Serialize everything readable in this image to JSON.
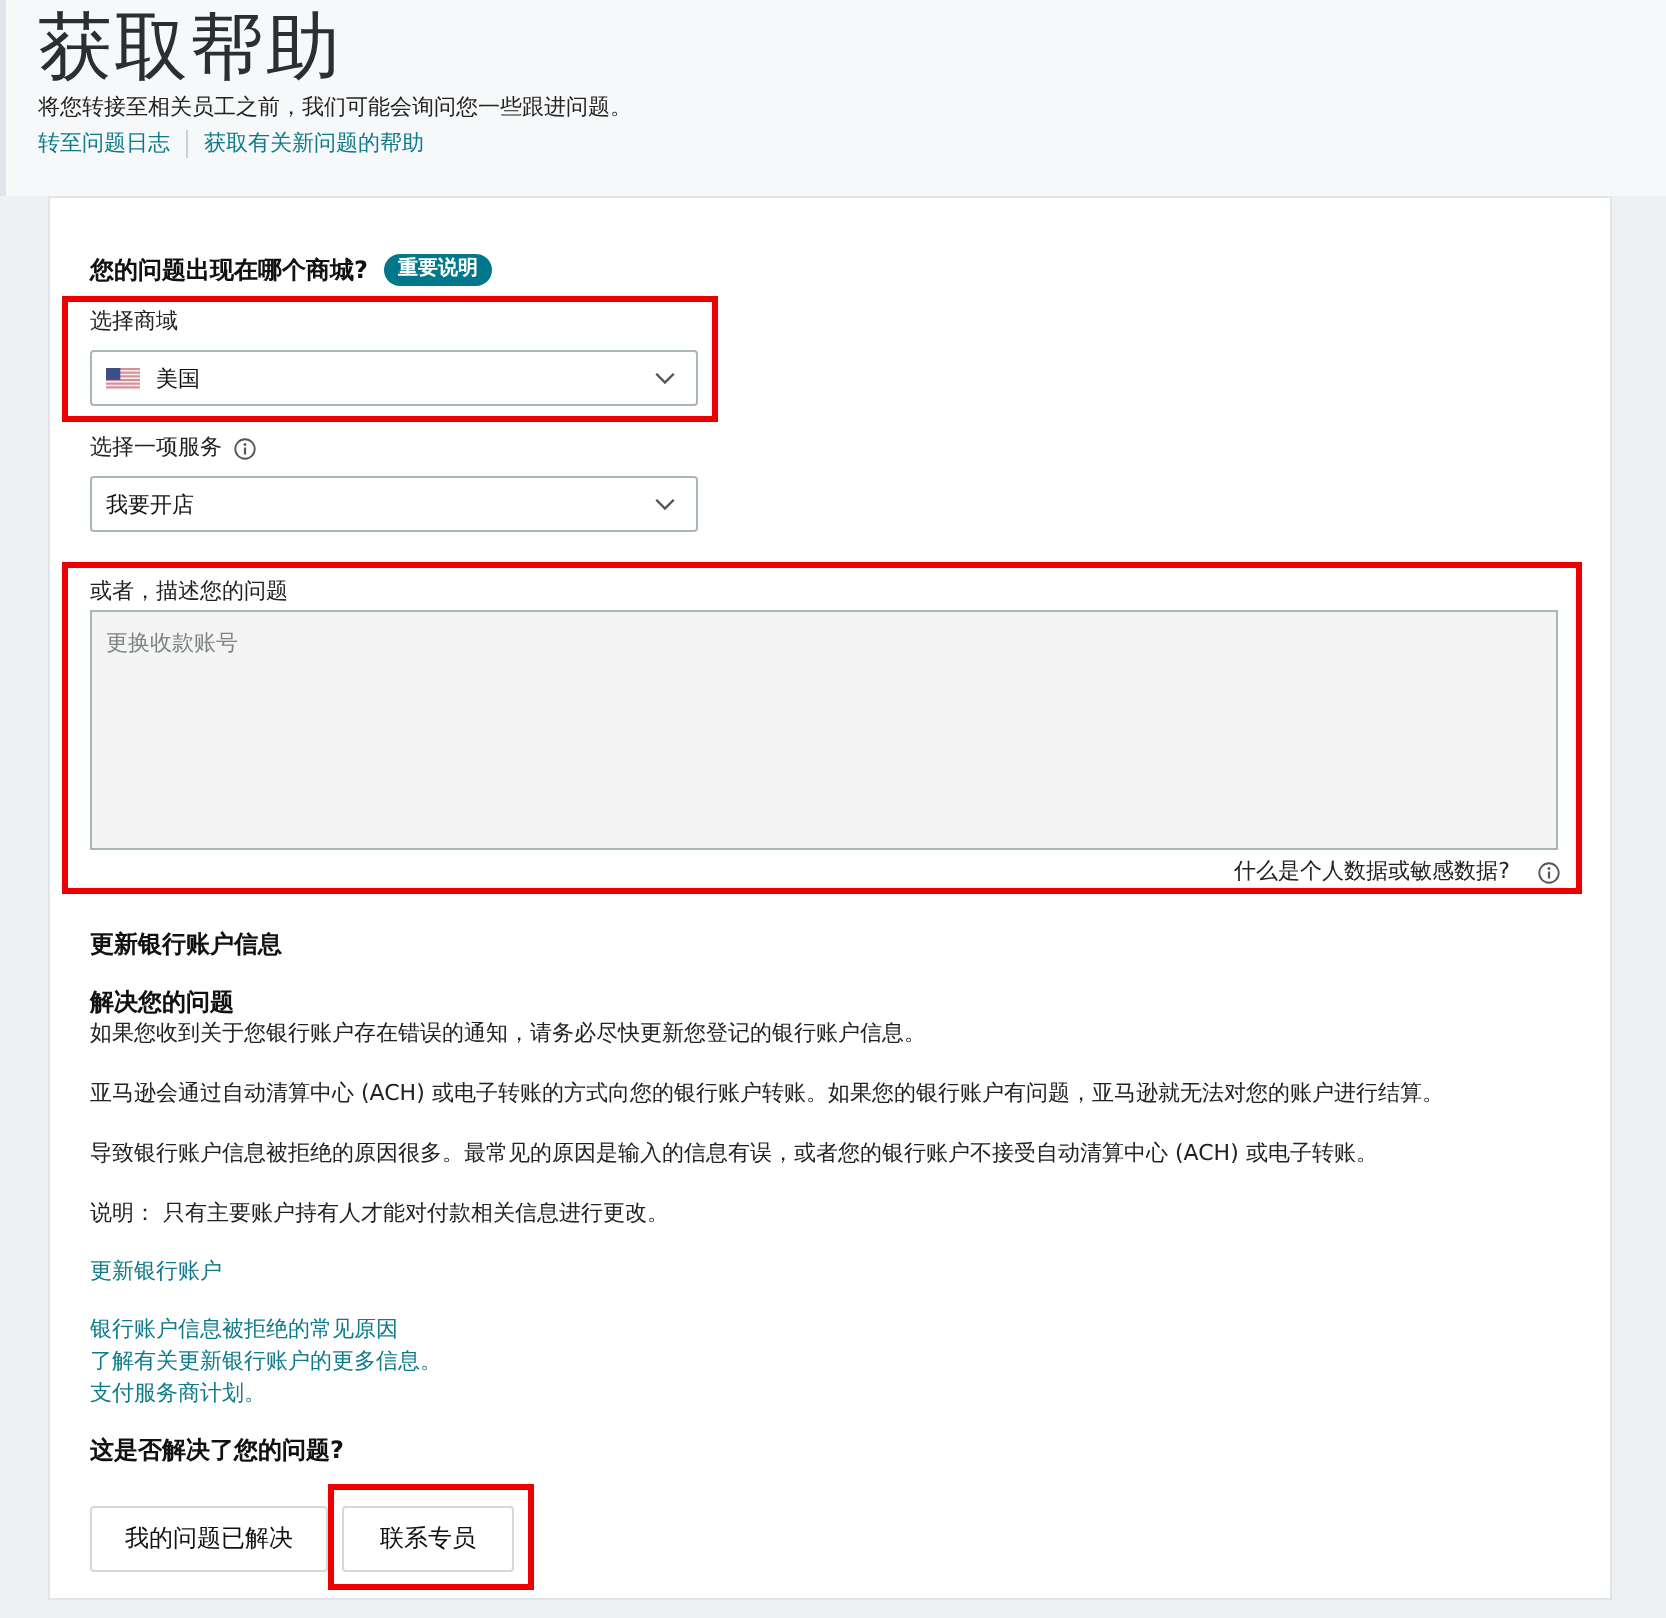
{
  "header": {
    "title": "获取帮助",
    "subtitle": "将您转接至相关员工之前，我们可能会询问您一些跟进问题。",
    "links": [
      "转至问题日志",
      "获取有关新问题的帮助"
    ]
  },
  "marketplace": {
    "question": "您的问题出现在哪个商城?",
    "badge": "重要说明"
  },
  "store_select": {
    "label": "选择商域",
    "value": "美国",
    "highlighted": true
  },
  "service_select": {
    "label": "选择一项服务",
    "value": "我要开店"
  },
  "description": {
    "label": "或者，描述您的问题",
    "placeholder": "更换收款账号",
    "hint": "什么是个人数据或敏感数据?",
    "highlighted": true
  },
  "article": {
    "title": "更新银行账户信息",
    "subtitle": "解决您的问题",
    "paragraphs": [
      "如果您收到关于您银行账户存在错误的通知，请务必尽快更新您登记的银行账户信息。",
      "亚马逊会通过自动清算中心 (ACH) 或电子转账的方式向您的银行账户转账。如果您的银行账户有问题，亚马逊就无法对您的账户进行结算。",
      "导致银行账户信息被拒绝的原因很多。最常见的原因是输入的信息有误，或者您的银行账户不接受自动清算中心 (ACH) 或电子转账。",
      "说明： 只有主要账户持有人才能对付款相关信息进行更改。"
    ],
    "link_groups": [
      [
        "更新银行账户"
      ],
      [
        "银行账户信息被拒绝的常见原因",
        "了解有关更新银行账户的更多信息。",
        "支付服务商计划。"
      ]
    ]
  },
  "feedback": {
    "question": "这是否解决了您的问题?",
    "buttons": [
      {
        "label": "我的问题已解决",
        "highlighted": false
      },
      {
        "label": "联系专员",
        "highlighted": true
      }
    ]
  }
}
